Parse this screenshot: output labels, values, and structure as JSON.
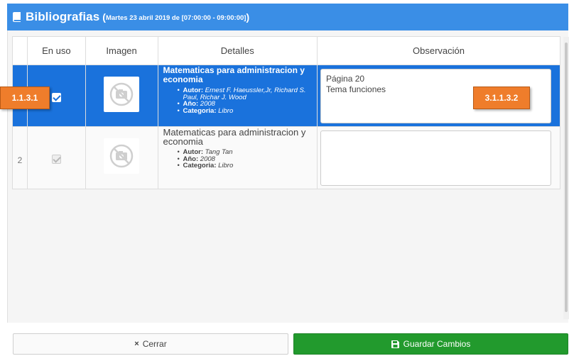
{
  "header": {
    "title": "Bibliografias",
    "open_paren": "(",
    "subtitle": "Martes 23 abril 2019 de [07:00:00 - 09:00:00]",
    "close_paren": ")"
  },
  "table": {
    "columns": [
      "",
      "En uso",
      "Imagen",
      "Detalles",
      "Observación"
    ],
    "rows": [
      {
        "number": "",
        "in_use": true,
        "title": "Matematicas para administracion y economia",
        "details": [
          {
            "label": "Autor:",
            "value": "Ernest F. Haeussler,Jr, Richard S. Paul, Richar J. Wood"
          },
          {
            "label": "Año:",
            "value": "2008"
          },
          {
            "label": "Categoria:",
            "value": "Libro"
          }
        ],
        "observation": "Página 20\nTema funciones"
      },
      {
        "number": "2",
        "in_use": true,
        "title": "Matematicas para administracion y economia",
        "details": [
          {
            "label": "Autor:",
            "value": "Tang Tan"
          },
          {
            "label": "Año:",
            "value": "2008"
          },
          {
            "label": "Categoria:",
            "value": "Libro"
          }
        ],
        "observation": ""
      }
    ]
  },
  "markers": {
    "checkbox_marker": "1.1.3.1",
    "observation_marker": "3.1.1.3.2"
  },
  "buttons": {
    "close_icon": "×",
    "close_label": "Cerrar",
    "save_icon": "floppy-disk-icon",
    "save_label": "Guardar Cambios"
  },
  "colors": {
    "header": "#3a8ee6",
    "selected_row": "#1a72dc",
    "save_button": "#229a2d",
    "marker": "#ef7d2b"
  }
}
